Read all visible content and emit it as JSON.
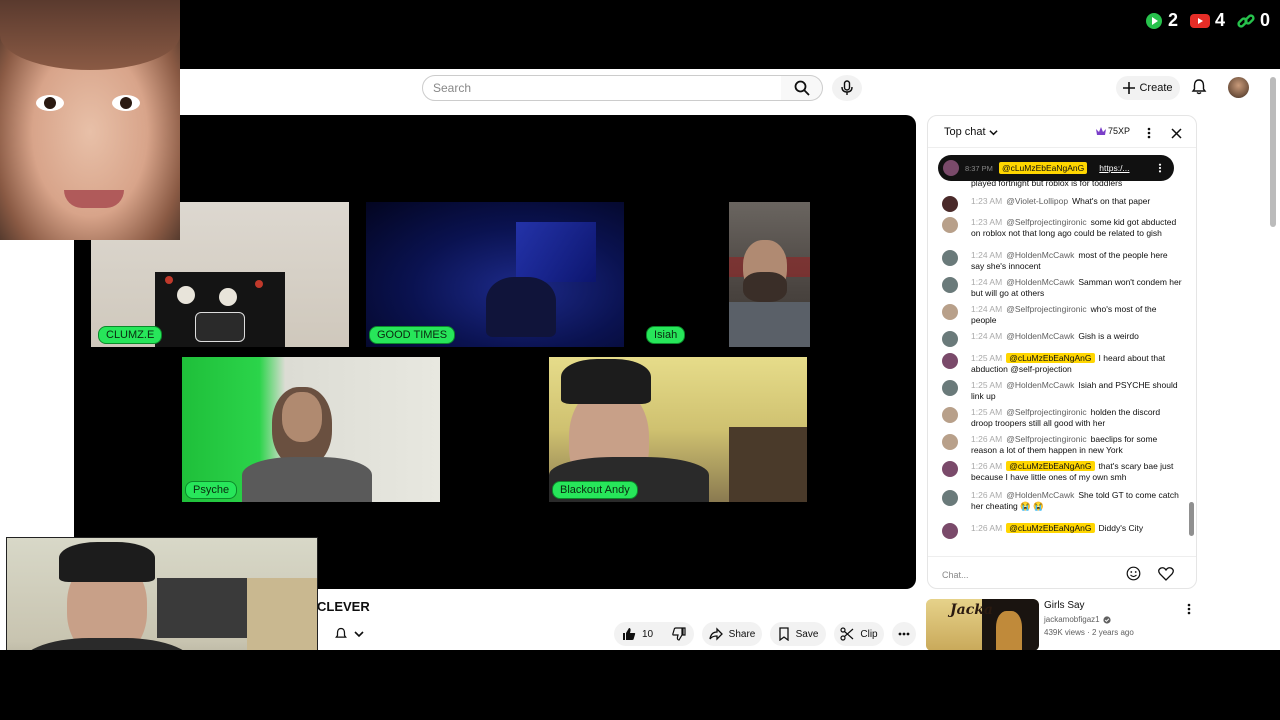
{
  "overlay_stats": [
    {
      "icon": "play-icon",
      "value": "2",
      "color": "#27c24c"
    },
    {
      "icon": "youtube-icon",
      "value": "4",
      "color": "#e52d27"
    },
    {
      "icon": "link-icon",
      "value": "0",
      "color": "#27c24c"
    }
  ],
  "masthead": {
    "search_placeholder": "Search",
    "create_label": "Create"
  },
  "video": {
    "participants": [
      {
        "name": "CLUMZ.E"
      },
      {
        "name": "GOOD TIMES"
      },
      {
        "name": "Isiah"
      },
      {
        "name": "Psyche"
      },
      {
        "name": "Blackout Andy"
      }
    ]
  },
  "below_video": {
    "title": "CLEVER",
    "like_count": "10",
    "share_label": "Share",
    "save_label": "Save",
    "clip_label": "Clip"
  },
  "chat": {
    "title": "Top chat",
    "xp": "75XP",
    "pinned": {
      "time": "8:37 PM",
      "author": "@cLuMzEbEaNgAnG",
      "text": "https:/..."
    },
    "messages": [
      {
        "time": "",
        "author": "",
        "text": "played fortnight but roblox is for toddlers",
        "highlight": false,
        "avatar": "#b07a5a"
      },
      {
        "time": "1:23 AM",
        "author": "@Violet-Lollipop",
        "text": "What's on that paper",
        "highlight": false,
        "avatar": "#4a2a2a"
      },
      {
        "time": "1:23 AM",
        "author": "@Selfprojectingironic",
        "text": "some kid got abducted on roblox not that long ago could be related to gish",
        "highlight": false,
        "avatar": "#b8a08a"
      },
      {
        "time": "1:24 AM",
        "author": "@HoldenMcCawk",
        "text": "most of the people here say she's innocent",
        "highlight": false,
        "avatar": "#6a7a7a"
      },
      {
        "time": "1:24 AM",
        "author": "@HoldenMcCawk",
        "text": "Samman won't condem her but will go at others",
        "highlight": false,
        "avatar": "#6a7a7a"
      },
      {
        "time": "1:24 AM",
        "author": "@Selfprojectingironic",
        "text": "who's most of the people",
        "highlight": false,
        "avatar": "#b8a08a"
      },
      {
        "time": "1:24 AM",
        "author": "@HoldenMcCawk",
        "text": "Gish is a weirdo",
        "highlight": false,
        "avatar": "#6a7a7a"
      },
      {
        "time": "1:25 AM",
        "author": "@cLuMzEbEaNgAnG",
        "text": "I heard about that abduction @self-projection",
        "highlight": true,
        "avatar": "#7a4a6a"
      },
      {
        "time": "1:25 AM",
        "author": "@HoldenMcCawk",
        "text": "Isiah and PSYCHE should link up",
        "highlight": false,
        "avatar": "#6a7a7a"
      },
      {
        "time": "1:25 AM",
        "author": "@Selfprojectingironic",
        "text": "holden the discord droop troopers still all good with her",
        "highlight": false,
        "avatar": "#b8a08a"
      },
      {
        "time": "1:26 AM",
        "author": "@Selfprojectingironic",
        "text": "baeclips for some reason a lot of them happen in new York",
        "highlight": false,
        "avatar": "#b8a08a"
      },
      {
        "time": "1:26 AM",
        "author": "@cLuMzEbEaNgAnG",
        "text": "that's scary bae just because I have little ones of my own smh",
        "highlight": true,
        "avatar": "#7a4a6a"
      },
      {
        "time": "1:26 AM",
        "author": "@HoldenMcCawk",
        "text": "She told GT to come catch her cheating 😭 😭",
        "highlight": false,
        "avatar": "#6a7a7a"
      },
      {
        "time": "1:26 AM",
        "author": "@cLuMzEbEaNgAnG",
        "text": "Diddy's City",
        "highlight": true,
        "avatar": "#7a4a6a"
      }
    ],
    "input_placeholder": "Chat..."
  },
  "recommendation": {
    "title": "Girls Say",
    "channel": "jackamobfigaz1",
    "meta": "439K views · 2 years ago",
    "thumb_text": "Jacka"
  }
}
